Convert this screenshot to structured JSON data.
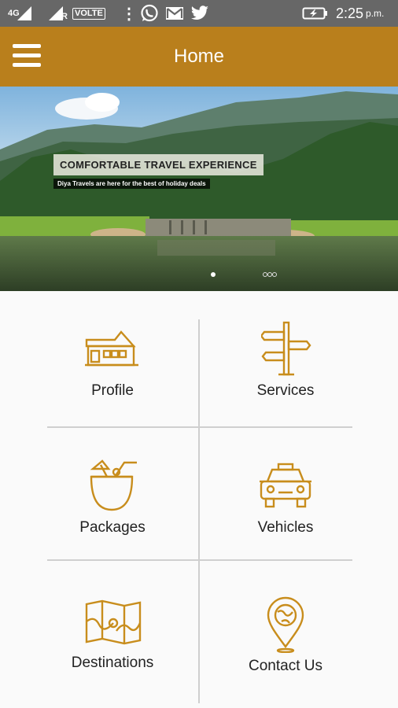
{
  "status_bar": {
    "network_type": "4G",
    "sim2_label": "R",
    "volte": "VOLTE",
    "menu_dots": "⋮",
    "notification_icons": [
      "whatsapp-icon",
      "gmail-icon",
      "twitter-icon"
    ],
    "battery": "charging",
    "time": "2:25",
    "ampm": "p.m."
  },
  "app_bar": {
    "menu_icon": "hamburger-icon",
    "title": "Home"
  },
  "banner": {
    "caption_title": "COMFORTABLE TRAVEL EXPERIENCE",
    "caption_subtitle": "Diya Travels  are here for the best of holiday deals",
    "slide_count": 4,
    "active_slide": 1
  },
  "menu": {
    "tiles": [
      {
        "label": "Profile",
        "icon": "house-icon"
      },
      {
        "label": "Services",
        "icon": "signpost-icon"
      },
      {
        "label": "Packages",
        "icon": "coconut-drink-icon"
      },
      {
        "label": "Vehicles",
        "icon": "taxi-icon"
      },
      {
        "label": "Destinations",
        "icon": "map-icon"
      },
      {
        "label": "Contact Us",
        "icon": "location-pin-icon"
      }
    ]
  },
  "colors": {
    "accent": "#b97f1c",
    "icon_stroke": "#c88d1c",
    "status_bar": "#676767"
  }
}
